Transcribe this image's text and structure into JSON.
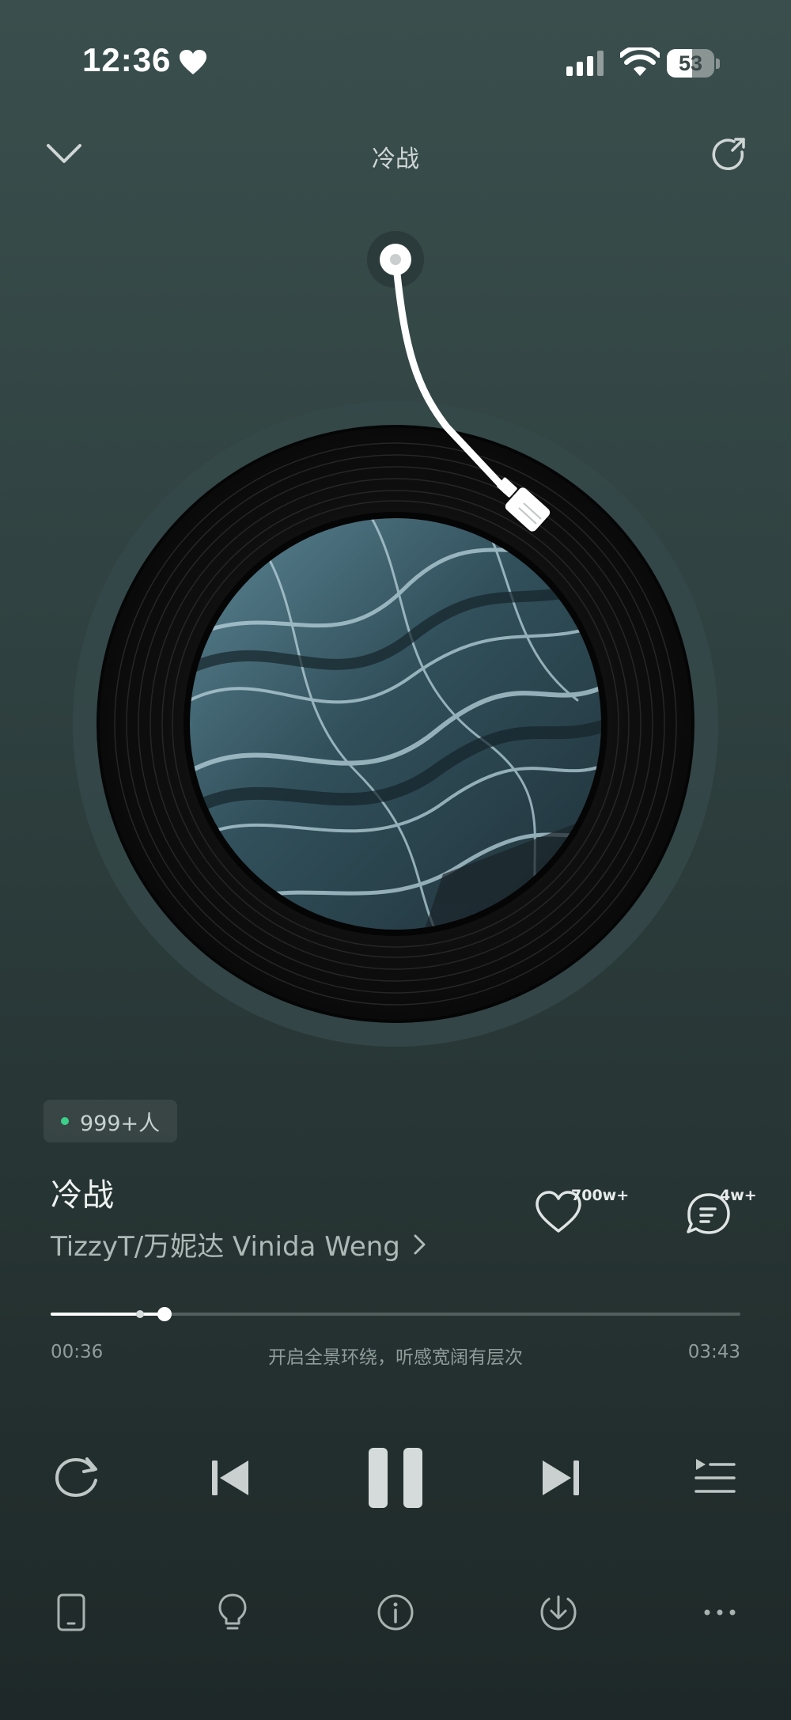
{
  "status_bar": {
    "time": "12:36",
    "battery_level": "53",
    "battery_fraction": 0.53,
    "icons": [
      "heart-icon",
      "signal-icon",
      "wifi-icon",
      "battery-icon"
    ]
  },
  "header": {
    "title": "冷战",
    "left_icon": "chevron-down-icon",
    "right_icon": "share-icon"
  },
  "listeners": {
    "count": "999+人"
  },
  "song": {
    "title": "冷战",
    "artist": "TizzyT/万妮达 Vinida Weng"
  },
  "actions": {
    "like_count": "700w+",
    "comment_count": "4w+"
  },
  "progress": {
    "current": "00:36",
    "total": "03:43",
    "played_fraction": 0.165,
    "buffered_fraction": 0.13,
    "tip": "开启全景环绕，听感宽阔有层次"
  },
  "controls": [
    "repeat-icon",
    "previous-icon",
    "pause-icon",
    "next-icon",
    "playlist-icon"
  ],
  "bottom_bar": [
    "phone-icon",
    "lightbulb-icon",
    "info-icon",
    "download-icon",
    "more-icon"
  ],
  "colors": {
    "background_top": "#3a4f4d",
    "background_bottom": "#1e2828",
    "accent_dot": "#3cd08a"
  }
}
